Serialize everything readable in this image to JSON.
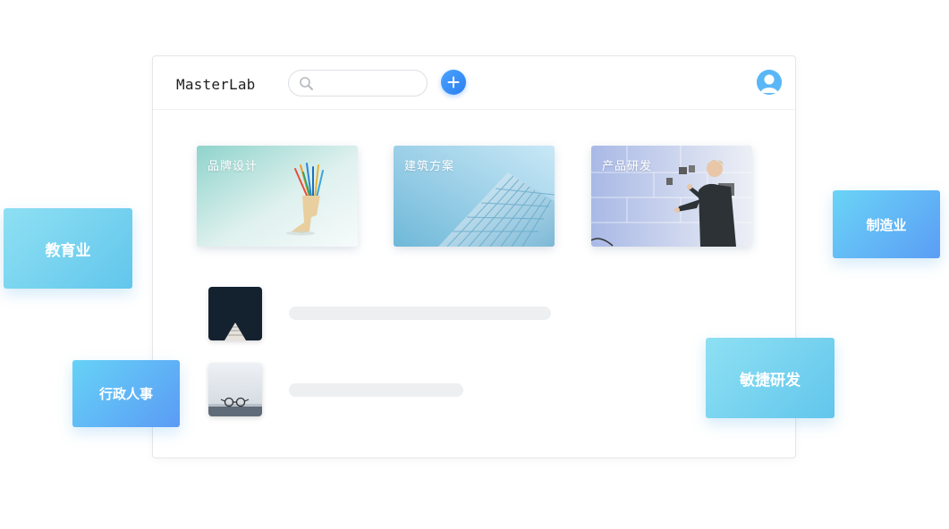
{
  "app": {
    "logo": "MasterLab",
    "search": {
      "placeholder": "",
      "value": ""
    },
    "add_button_icon": "plus-icon",
    "avatar_icon": "user-avatar-icon"
  },
  "project_cards": [
    {
      "label": "品牌设计",
      "image": "pencil-holder-photo"
    },
    {
      "label": "建筑方案",
      "image": "building-facade-photo"
    },
    {
      "label": "产品研发",
      "image": "man-at-whiteboard-photo"
    }
  ],
  "list_items": [
    {
      "image": "dark-building-thumbnail"
    },
    {
      "image": "glasses-on-desk-thumbnail"
    }
  ],
  "floating_tags": {
    "education": "教育业",
    "admin_hr": "行政人事",
    "manufacturing": "制造业",
    "agile_dev": "敏捷研发"
  },
  "colors": {
    "accent": "#2b7ef0",
    "tag_gradient_start": "#8ee0f3",
    "tag_gradient_end": "#5a9bf5",
    "placeholder": "#eeeff1"
  }
}
